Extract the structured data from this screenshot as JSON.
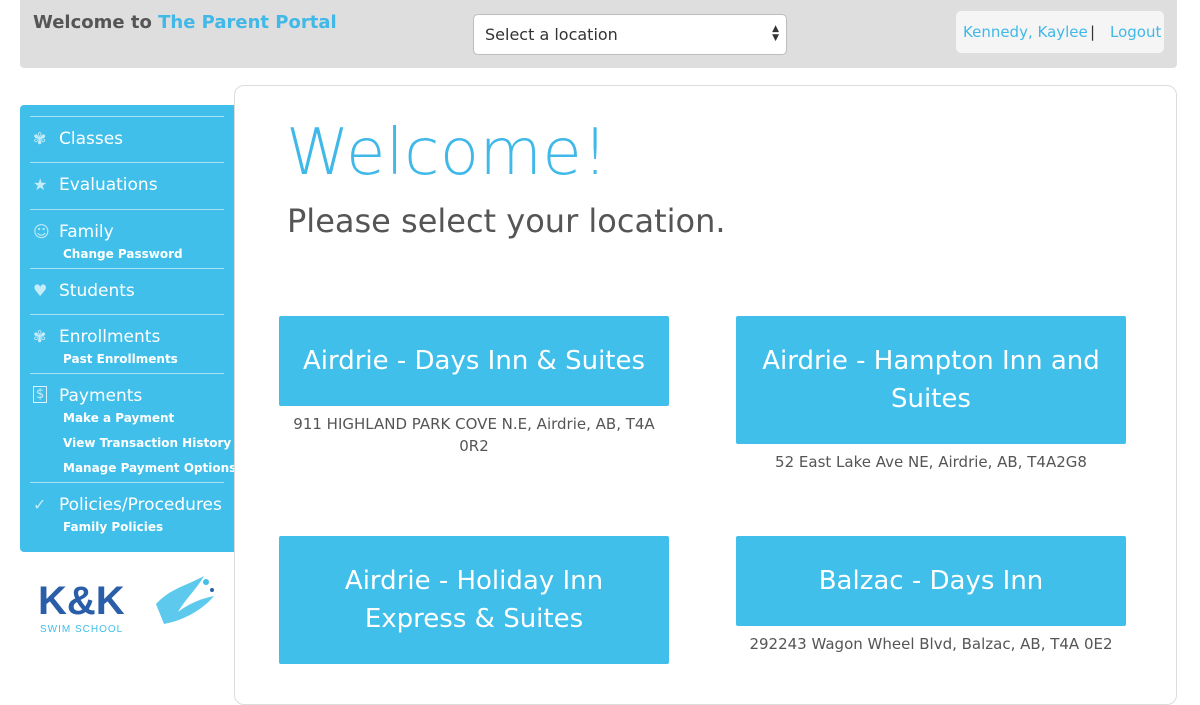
{
  "header": {
    "brand_prefix": "Welcome to",
    "brand_name": "The Parent Portal",
    "location_select": {
      "selected": "Select a location"
    },
    "user_name": "Kennedy, Kaylee",
    "separator": "|",
    "logout_label": "Logout"
  },
  "sidebar": {
    "items": [
      {
        "label": "Classes",
        "icon": "classes-icon",
        "subs": []
      },
      {
        "label": "Evaluations",
        "icon": "star-icon",
        "subs": []
      },
      {
        "label": "Family",
        "icon": "family-icon",
        "subs": [
          "Change Password"
        ]
      },
      {
        "label": "Students",
        "icon": "student-icon",
        "subs": []
      },
      {
        "label": "Enrollments",
        "icon": "enrollments-icon",
        "subs": [
          "Past Enrollments"
        ]
      },
      {
        "label": "Payments",
        "icon": "dollar-icon",
        "subs": [
          "Make a Payment",
          "View Transaction History",
          "Manage Payment Options"
        ]
      },
      {
        "label": "Policies/Procedures",
        "icon": "checkmark-icon",
        "subs": [
          "Family Policies"
        ]
      }
    ]
  },
  "logo": {
    "main": "K&K",
    "tagline": "SWIM SCHOOL"
  },
  "main": {
    "title": "Welcome!",
    "subtitle": "Please select your location.",
    "locations": [
      {
        "name": "Airdrie - Days Inn & Suites",
        "address": "911 HIGHLAND PARK COVE N.E, Airdrie, AB, T4A 0R2"
      },
      {
        "name": "Airdrie - Hampton Inn and Suites",
        "address": "52 East Lake Ave NE, Airdrie, AB, T4A2G8"
      },
      {
        "name": "Airdrie - Holiday Inn Express & Suites",
        "address": ""
      },
      {
        "name": "Balzac - Days Inn",
        "address": "292243 Wagon Wheel Blvd, Balzac, AB, T4A 0E2"
      }
    ]
  },
  "colors": {
    "accent": "#40bfea",
    "topbar": "#dedede",
    "logo_blue": "#2a5ea8"
  }
}
